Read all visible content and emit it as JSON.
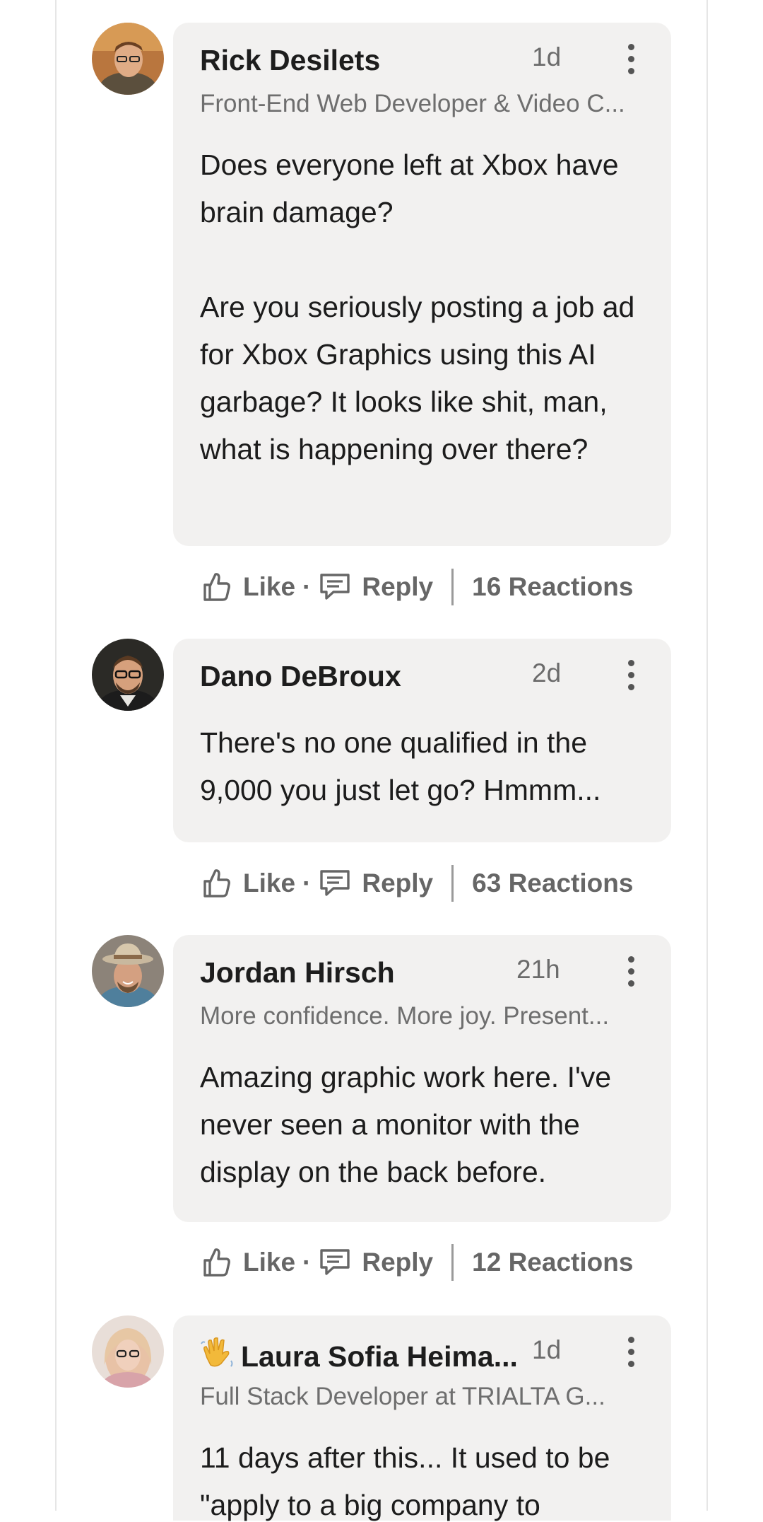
{
  "comments": [
    {
      "name": "Rick Desilets",
      "time": "1d",
      "headline": "Front-End Web Developer & Video C...",
      "text": "Does everyone left at Xbox have brain damage?\n\nAre you seriously posting a job ad for Xbox Graphics using this AI garbage?  It looks like shit, man, what is happening over there?",
      "like_label": "Like",
      "reply_label": "Reply",
      "reactions": "16 Reactions"
    },
    {
      "name": "Dano DeBroux",
      "time": "2d",
      "headline": "",
      "text": "There's no one qualified in the 9,000 you just let go? Hmmm...",
      "like_label": "Like",
      "reply_label": "Reply",
      "reactions": "63 Reactions"
    },
    {
      "name": "Jordan Hirsch",
      "time": "21h",
      "headline": "More confidence. More joy. Present...",
      "text": "Amazing graphic work here. I've never seen a monitor with the display on the back before.",
      "like_label": "Like",
      "reply_label": "Reply",
      "reactions": "12 Reactions"
    },
    {
      "name": "Laura Sofia Heima...",
      "time": "1d",
      "headline": "Full Stack Developer at TRIALTA G...",
      "text": "11 days after this... It used to be \"apply to a big company to",
      "like_label": "Like",
      "reply_label": "Reply",
      "reactions": ""
    }
  ],
  "icons": {
    "like": "thumbs-up-icon",
    "reply": "speech-bubble-icon",
    "more": "vertical-ellipsis-icon",
    "wave": "waving-hand-icon"
  }
}
